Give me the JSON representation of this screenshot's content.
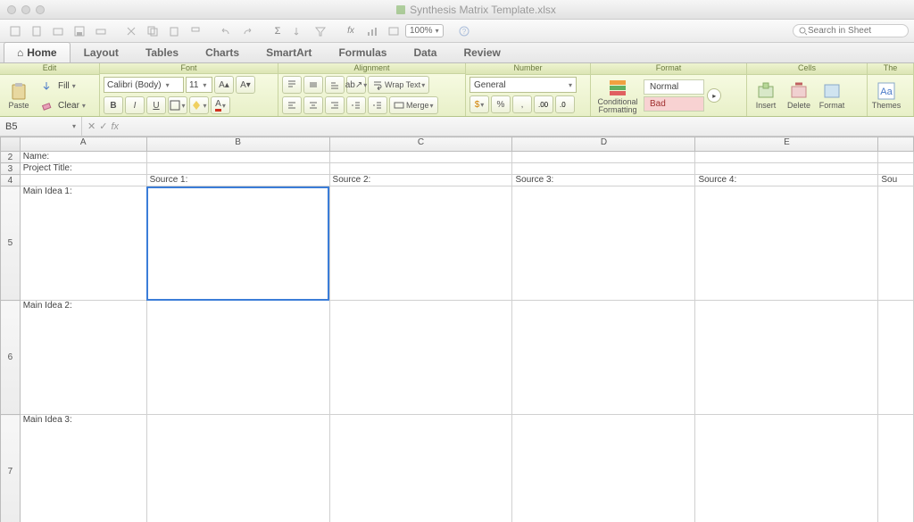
{
  "window": {
    "title": "Synthesis Matrix Template.xlsx"
  },
  "quickbar": {
    "zoom": "100%",
    "search_placeholder": "Search in Sheet"
  },
  "tabs": [
    "Home",
    "Layout",
    "Tables",
    "Charts",
    "SmartArt",
    "Formulas",
    "Data",
    "Review"
  ],
  "ribbon": {
    "groups": {
      "edit": {
        "label": "Edit",
        "paste": "Paste",
        "fill": "Fill",
        "clear": "Clear"
      },
      "font": {
        "label": "Font",
        "name": "Calibri (Body)",
        "size": "11",
        "bold": "B",
        "italic": "I",
        "underline": "U"
      },
      "alignment": {
        "label": "Alignment",
        "wrap": "Wrap Text",
        "merge": "Merge"
      },
      "number": {
        "label": "Number",
        "format": "General",
        "percent": "%",
        "comma": ",",
        "currency": "$"
      },
      "format": {
        "label": "Format",
        "cond": "Conditional Formatting",
        "normal": "Normal",
        "bad": "Bad"
      },
      "cells": {
        "label": "Cells",
        "insert": "Insert",
        "delete": "Delete",
        "fmt": "Format"
      },
      "themes": {
        "label": "Themes",
        "btn": "Themes",
        "aa": "Aa"
      }
    }
  },
  "formulabar": {
    "namebox": "B5",
    "fx": "fx"
  },
  "sheet": {
    "cols": [
      "A",
      "B",
      "C",
      "D",
      "E"
    ],
    "rows": {
      "2": {
        "A": "Name:"
      },
      "3": {
        "A": "Project Title:"
      },
      "4": {
        "B": "Source 1:",
        "C": "Source 2:",
        "D": "Source 3:",
        "E": "Source 4:",
        "F": "Sou"
      },
      "5": {
        "A": "Main Idea 1:"
      },
      "6": {
        "A": "Main Idea 2:"
      },
      "7": {
        "A": "Main Idea 3:"
      }
    },
    "selected": "B5"
  }
}
